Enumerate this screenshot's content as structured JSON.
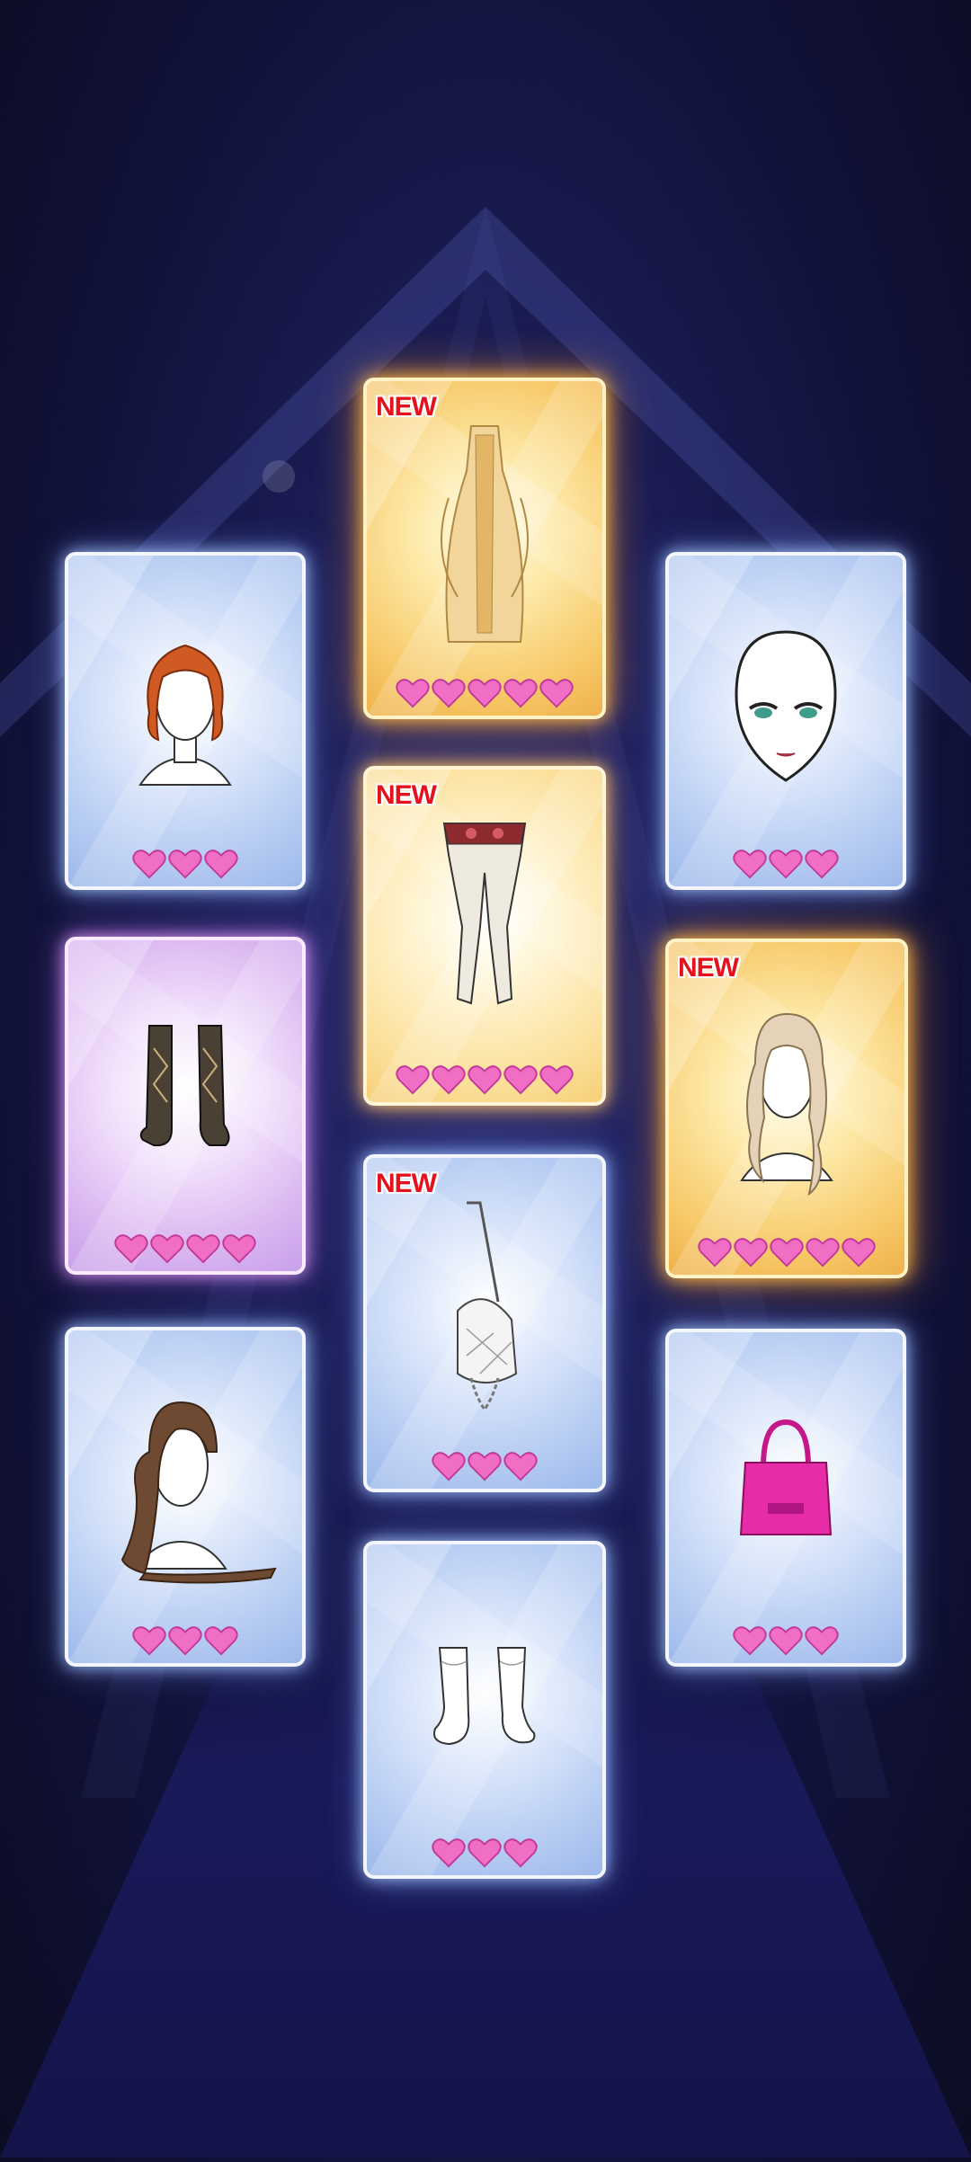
{
  "cards": [
    {
      "id": "hair-orange-bob",
      "item": "orange-bob-hair",
      "new_label": "",
      "hearts": 3,
      "rarity": "blue"
    },
    {
      "id": "gold-dress",
      "item": "gold-gown",
      "new_label": "NEW",
      "hearts": 5,
      "rarity": "gold"
    },
    {
      "id": "face-makeup",
      "item": "face-makeup",
      "new_label": "",
      "hearts": 3,
      "rarity": "blue"
    },
    {
      "id": "argyle-socks",
      "item": "argyle-socks",
      "new_label": "",
      "hearts": 4,
      "rarity": "purple"
    },
    {
      "id": "tights",
      "item": "lace-tights",
      "new_label": "NEW",
      "hearts": 5,
      "rarity": "yellow"
    },
    {
      "id": "wavy-blonde-hair",
      "item": "wavy-blonde-hair",
      "new_label": "NEW",
      "hearts": 5,
      "rarity": "gold"
    },
    {
      "id": "long-brown-hair",
      "item": "long-brown-hair",
      "new_label": "",
      "hearts": 3,
      "rarity": "blue"
    },
    {
      "id": "quilted-bag",
      "item": "white-quilted-bag",
      "new_label": "NEW",
      "hearts": 3,
      "rarity": "blue"
    },
    {
      "id": "pink-bag",
      "item": "pink-mini-bag",
      "new_label": "",
      "hearts": 3,
      "rarity": "blue"
    },
    {
      "id": "white-socks",
      "item": "white-slouch-socks",
      "new_label": "",
      "hearts": 3,
      "rarity": "blue"
    }
  ],
  "colors": {
    "heart": "#f06ec3",
    "heart_outline": "#c2389a",
    "new": "#e3121d"
  }
}
